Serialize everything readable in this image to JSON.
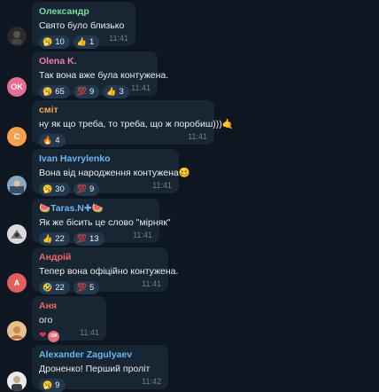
{
  "messages": [
    {
      "sender": "Олександр",
      "sender_color": "#7fd9a0",
      "avatar_initials": "",
      "avatar_bg": "#222",
      "text": "Свято було близько",
      "reactions": [
        {
          "emoji": "🥱",
          "count": "10"
        },
        {
          "emoji": "👍",
          "count": "1"
        }
      ],
      "time": "11:41"
    },
    {
      "sender": "Olena K.",
      "sender_color": "#ee7aae",
      "avatar_initials": "OK",
      "avatar_bg": "#e86d92",
      "text": "Так вона вже була контужена.",
      "reactions": [
        {
          "emoji": "🥱",
          "count": "65"
        },
        {
          "emoji": "💯",
          "count": "9"
        },
        {
          "emoji": "👍",
          "count": "3"
        }
      ],
      "time": "11:41"
    },
    {
      "sender": "сміт",
      "sender_color": "#f2a856",
      "avatar_initials": "C",
      "avatar_bg": "#f5a04e",
      "text": "ну як що треба, то треба, що ж поробиш)))🤙",
      "reactions": [
        {
          "emoji": "🔥",
          "count": "4"
        }
      ],
      "time": "11:41"
    },
    {
      "sender": "Ivan Havrylenko",
      "sender_color": "#6cb6f0",
      "avatar_initials": "",
      "avatar_bg": "#4a6a8a",
      "text": "Вона від народження контужена🥴",
      "reactions": [
        {
          "emoji": "🥱",
          "count": "30"
        },
        {
          "emoji": "💯",
          "count": "9"
        }
      ],
      "time": "11:41"
    },
    {
      "sender": "🍉Taras.N✚🍉",
      "sender_color": "#6cb6f0",
      "avatar_initials": "",
      "avatar_bg": "#cfcfcf",
      "text": "Як же бісить це слово \"мірняк\"",
      "reactions": [
        {
          "emoji": "👍",
          "count": "22"
        },
        {
          "emoji": "💯",
          "count": "13"
        }
      ],
      "time": "11:41"
    },
    {
      "sender": "Андрій",
      "sender_color": "#f06767",
      "avatar_initials": "A",
      "avatar_bg": "#e25f5f",
      "text": "Тепер вона офіційно контужена.",
      "reactions": [
        {
          "emoji": "🤣",
          "count": "22"
        },
        {
          "emoji": "💯",
          "count": "5"
        }
      ],
      "time": "11:41"
    },
    {
      "sender": "Аня",
      "sender_color": "#f06767",
      "avatar_initials": "",
      "avatar_bg": "#d49b6a",
      "text": "ого",
      "reactions": [],
      "time": "11:41"
    },
    {
      "sender": "Alexander Zagulyaev",
      "sender_color": "#6cb6f0",
      "avatar_initials": "",
      "avatar_bg": "#e5e5e5",
      "text": "Дроненко! Перший проліт",
      "reactions": [
        {
          "emoji": "🥱",
          "count": "9"
        }
      ],
      "time": "11:42"
    }
  ],
  "m7_reactions": {
    "heart": "❤",
    "mini_avatar": "ОК"
  }
}
